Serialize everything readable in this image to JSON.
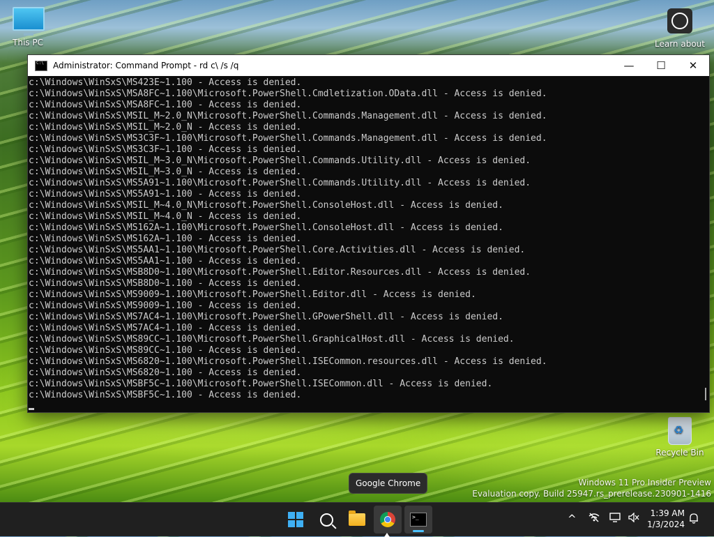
{
  "desktop": {
    "icons": [
      {
        "label": "This PC"
      },
      {
        "label": "Learn about"
      },
      {
        "label": "Recycle Bin"
      }
    ],
    "watermark": {
      "line1": "Windows 11 Pro Insider Preview",
      "line2": "Evaluation copy. Build 25947.rs_prerelease.230901-1416"
    }
  },
  "window": {
    "title": "Administrator: Command Prompt - rd  c\\ /s /q",
    "buttons": {
      "minimize": "—",
      "maximize": "☐",
      "close": "✕"
    },
    "lines": [
      "c:\\Windows\\WinSxS\\MS423E~1.100 - Access is denied.",
      "c:\\Windows\\WinSxS\\MSA8FC~1.100\\Microsoft.PowerShell.Cmdletization.OData.dll - Access is denied.",
      "c:\\Windows\\WinSxS\\MSA8FC~1.100 - Access is denied.",
      "c:\\Windows\\WinSxS\\MSIL_M~2.0_N\\Microsoft.PowerShell.Commands.Management.dll - Access is denied.",
      "c:\\Windows\\WinSxS\\MSIL_M~2.0_N - Access is denied.",
      "c:\\Windows\\WinSxS\\MS3C3F~1.100\\Microsoft.PowerShell.Commands.Management.dll - Access is denied.",
      "c:\\Windows\\WinSxS\\MS3C3F~1.100 - Access is denied.",
      "c:\\Windows\\WinSxS\\MSIL_M~3.0_N\\Microsoft.PowerShell.Commands.Utility.dll - Access is denied.",
      "c:\\Windows\\WinSxS\\MSIL_M~3.0_N - Access is denied.",
      "c:\\Windows\\WinSxS\\MS5A91~1.100\\Microsoft.PowerShell.Commands.Utility.dll - Access is denied.",
      "c:\\Windows\\WinSxS\\MS5A91~1.100 - Access is denied.",
      "c:\\Windows\\WinSxS\\MSIL_M~4.0_N\\Microsoft.PowerShell.ConsoleHost.dll - Access is denied.",
      "c:\\Windows\\WinSxS\\MSIL_M~4.0_N - Access is denied.",
      "c:\\Windows\\WinSxS\\MS162A~1.100\\Microsoft.PowerShell.ConsoleHost.dll - Access is denied.",
      "c:\\Windows\\WinSxS\\MS162A~1.100 - Access is denied.",
      "c:\\Windows\\WinSxS\\MS5AA1~1.100\\Microsoft.PowerShell.Core.Activities.dll - Access is denied.",
      "c:\\Windows\\WinSxS\\MS5AA1~1.100 - Access is denied.",
      "c:\\Windows\\WinSxS\\MSB8D0~1.100\\Microsoft.PowerShell.Editor.Resources.dll - Access is denied.",
      "c:\\Windows\\WinSxS\\MSB8D0~1.100 - Access is denied.",
      "c:\\Windows\\WinSxS\\MS9009~1.100\\Microsoft.PowerShell.Editor.dll - Access is denied.",
      "c:\\Windows\\WinSxS\\MS9009~1.100 - Access is denied.",
      "c:\\Windows\\WinSxS\\MS7AC4~1.100\\Microsoft.PowerShell.GPowerShell.dll - Access is denied.",
      "c:\\Windows\\WinSxS\\MS7AC4~1.100 - Access is denied.",
      "c:\\Windows\\WinSxS\\MS89CC~1.100\\Microsoft.PowerShell.GraphicalHost.dll - Access is denied.",
      "c:\\Windows\\WinSxS\\MS89CC~1.100 - Access is denied.",
      "c:\\Windows\\WinSxS\\MS6820~1.100\\Microsoft.PowerShell.ISECommon.resources.dll - Access is denied.",
      "c:\\Windows\\WinSxS\\MS6820~1.100 - Access is denied.",
      "c:\\Windows\\WinSxS\\MSBF5C~1.100\\Microsoft.PowerShell.ISECommon.dll - Access is denied.",
      "c:\\Windows\\WinSxS\\MSBF5C~1.100 - Access is denied."
    ]
  },
  "tooltip": {
    "text": "Google Chrome"
  },
  "taskbar": {
    "apps": [
      {
        "name": "start",
        "icon": "windows-logo-icon"
      },
      {
        "name": "search",
        "icon": "search-icon"
      },
      {
        "name": "file-explorer",
        "icon": "folder-icon"
      },
      {
        "name": "chrome",
        "icon": "chrome-icon"
      },
      {
        "name": "command-prompt",
        "icon": "terminal-icon"
      }
    ],
    "tray": {
      "chevron": "^",
      "clock_time": "1:39 AM",
      "clock_date": "1/3/2024"
    }
  }
}
